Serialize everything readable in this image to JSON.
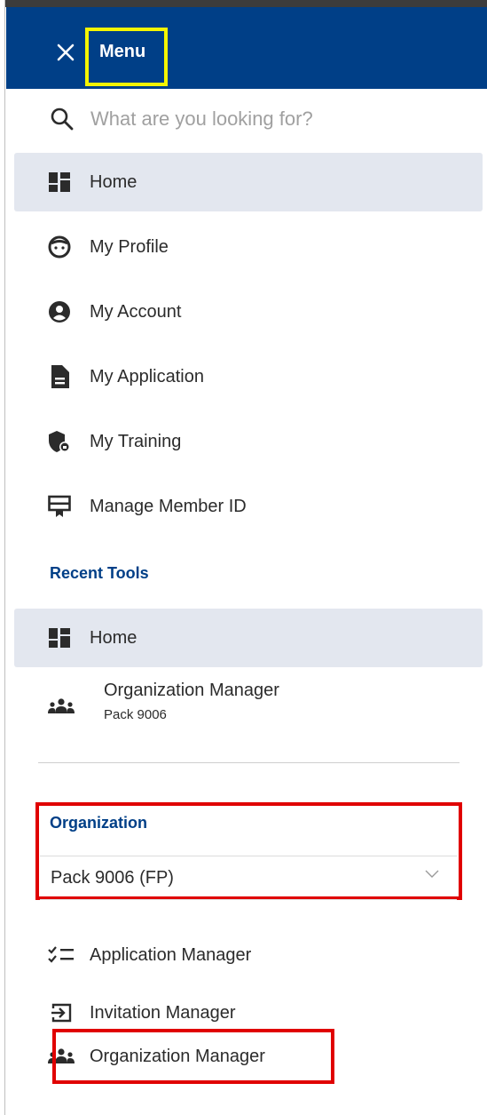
{
  "header": {
    "title": "Menu",
    "close_glyph": "✕",
    "background": "#003f87",
    "highlight_color": "#f5f500"
  },
  "search": {
    "placeholder": "What are you looking for?",
    "icon": "search-icon"
  },
  "nav": {
    "items": [
      {
        "label": "Home",
        "icon": "dashboard-icon",
        "active": true
      },
      {
        "label": "My Profile",
        "icon": "face-icon"
      },
      {
        "label": "My Account",
        "icon": "account-circle-icon"
      },
      {
        "label": "My Application",
        "icon": "document-icon"
      },
      {
        "label": "My Training",
        "icon": "shield-training-icon"
      },
      {
        "label": "Manage Member ID",
        "icon": "member-card-icon"
      }
    ]
  },
  "recent": {
    "title": "Recent Tools",
    "items": [
      {
        "label": "Home",
        "icon": "dashboard-icon",
        "active": true
      },
      {
        "label": "Organization Manager",
        "sublabel": "Pack 9006",
        "icon": "group-icon"
      }
    ]
  },
  "organization": {
    "title": "Organization",
    "selected": "Pack 9006 (FP)",
    "highlight_color": "#e00000"
  },
  "tools": {
    "items": [
      {
        "label": "Application Manager",
        "icon": "checklist-icon"
      },
      {
        "label": "Invitation Manager",
        "icon": "login-box-icon"
      },
      {
        "label": "Organization Manager",
        "icon": "group-icon"
      }
    ]
  },
  "colors": {
    "accent": "#003f87",
    "active_bg": "#e3e7ef",
    "text": "#2b2b2b"
  }
}
